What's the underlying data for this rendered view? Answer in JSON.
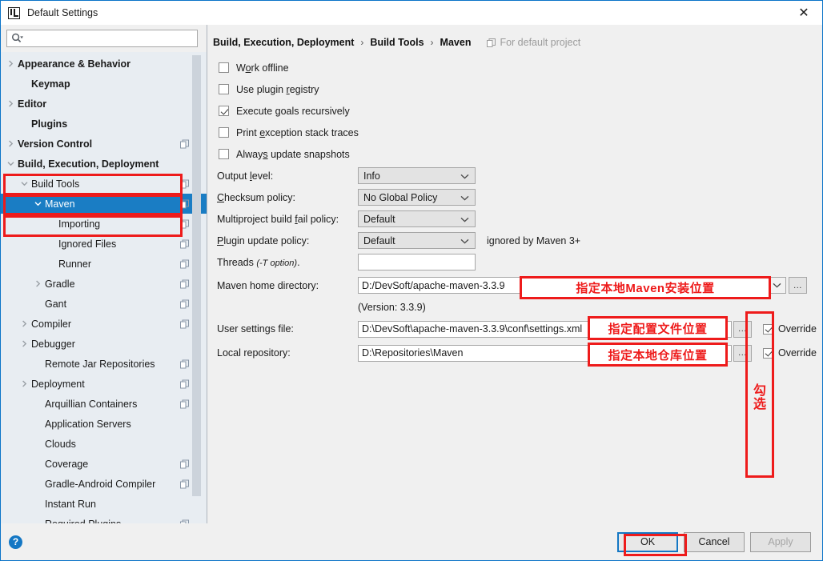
{
  "window": {
    "title": "Default Settings",
    "logo_icon": "intellij-idea-logo",
    "close_icon": "close-icon"
  },
  "search": {
    "placeholder": "",
    "value": "",
    "icon": "search-icon"
  },
  "sidebar": {
    "items": [
      {
        "label": "Appearance & Behavior",
        "arrow": "chevron-right",
        "bold": true,
        "indent": 0,
        "badge": false,
        "selected": false
      },
      {
        "label": "Keymap",
        "arrow": "none",
        "bold": true,
        "indent": 1,
        "badge": false,
        "selected": false
      },
      {
        "label": "Editor",
        "arrow": "chevron-right",
        "bold": true,
        "indent": 0,
        "badge": false,
        "selected": false
      },
      {
        "label": "Plugins",
        "arrow": "none",
        "bold": true,
        "indent": 1,
        "badge": false,
        "selected": false
      },
      {
        "label": "Version Control",
        "arrow": "chevron-right",
        "bold": true,
        "indent": 0,
        "badge": true,
        "selected": false
      },
      {
        "label": "Build, Execution, Deployment",
        "arrow": "chevron-down",
        "bold": true,
        "indent": 0,
        "badge": false,
        "selected": false
      },
      {
        "label": "Build Tools",
        "arrow": "chevron-down",
        "bold": false,
        "indent": 1,
        "badge": true,
        "selected": false
      },
      {
        "label": "Maven",
        "arrow": "chevron-down",
        "bold": false,
        "indent": 2,
        "badge": true,
        "selected": true
      },
      {
        "label": "Importing",
        "arrow": "none",
        "bold": false,
        "indent": 3,
        "badge": true,
        "selected": false
      },
      {
        "label": "Ignored Files",
        "arrow": "none",
        "bold": false,
        "indent": 3,
        "badge": true,
        "selected": false
      },
      {
        "label": "Runner",
        "arrow": "none",
        "bold": false,
        "indent": 3,
        "badge": true,
        "selected": false
      },
      {
        "label": "Gradle",
        "arrow": "chevron-right",
        "bold": false,
        "indent": 2,
        "badge": true,
        "selected": false
      },
      {
        "label": "Gant",
        "arrow": "none",
        "bold": false,
        "indent": 2,
        "badge": true,
        "selected": false
      },
      {
        "label": "Compiler",
        "arrow": "chevron-right",
        "bold": false,
        "indent": 1,
        "badge": true,
        "selected": false
      },
      {
        "label": "Debugger",
        "arrow": "chevron-right",
        "bold": false,
        "indent": 1,
        "badge": false,
        "selected": false
      },
      {
        "label": "Remote Jar Repositories",
        "arrow": "none",
        "bold": false,
        "indent": 2,
        "badge": true,
        "selected": false
      },
      {
        "label": "Deployment",
        "arrow": "chevron-right",
        "bold": false,
        "indent": 1,
        "badge": true,
        "selected": false
      },
      {
        "label": "Arquillian Containers",
        "arrow": "none",
        "bold": false,
        "indent": 2,
        "badge": true,
        "selected": false
      },
      {
        "label": "Application Servers",
        "arrow": "none",
        "bold": false,
        "indent": 2,
        "badge": false,
        "selected": false
      },
      {
        "label": "Clouds",
        "arrow": "none",
        "bold": false,
        "indent": 2,
        "badge": false,
        "selected": false
      },
      {
        "label": "Coverage",
        "arrow": "none",
        "bold": false,
        "indent": 2,
        "badge": true,
        "selected": false
      },
      {
        "label": "Gradle-Android Compiler",
        "arrow": "none",
        "bold": false,
        "indent": 2,
        "badge": true,
        "selected": false
      },
      {
        "label": "Instant Run",
        "arrow": "none",
        "bold": false,
        "indent": 2,
        "badge": false,
        "selected": false
      },
      {
        "label": "Required Plugins",
        "arrow": "none",
        "bold": false,
        "indent": 2,
        "badge": true,
        "selected": false
      }
    ]
  },
  "breadcrumb": {
    "crumbs": [
      "Build, Execution, Deployment",
      "Build Tools",
      "Maven"
    ],
    "separator": "›",
    "project_scope": "For default project",
    "project_scope_icon": "copy-badge-icon"
  },
  "main": {
    "checkboxes": [
      {
        "label": "Work offline",
        "mnemonic": "o",
        "checked": false
      },
      {
        "label": "Use plugin registry",
        "mnemonic": "r",
        "checked": false
      },
      {
        "label": "Execute goals recursively",
        "mnemonic": "g",
        "checked": true
      },
      {
        "label": "Print exception stack traces",
        "mnemonic": "e",
        "checked": false
      },
      {
        "label": "Always update snapshots",
        "mnemonic": "s",
        "checked": false
      }
    ],
    "combos": [
      {
        "label": "Output level:",
        "mnemonic": "l",
        "value": "Info",
        "hint": ""
      },
      {
        "label": "Checksum policy:",
        "mnemonic": "C",
        "value": "No Global Policy",
        "hint": ""
      },
      {
        "label": "Multiproject build fail policy:",
        "mnemonic": "f",
        "value": "Default",
        "hint": ""
      },
      {
        "label": "Plugin update policy:",
        "mnemonic": "P",
        "value": "Default",
        "hint": "ignored by Maven 3+"
      }
    ],
    "threads": {
      "label": "Threads",
      "label_suffix": "(-T option)",
      "value": ""
    },
    "maven_home": {
      "label": "Maven home directory:",
      "mnemonic": "h",
      "value": "D:/DevSoft/apache-maven-3.3.9",
      "chevron_icon": "chevron-down-icon",
      "browse_label": "...",
      "version_note": "(Version: 3.3.9)"
    },
    "user_settings": {
      "label": "User settings file:",
      "mnemonic": "s",
      "value": "D:\\DevSoft\\apache-maven-3.3.9\\conf\\settings.xml",
      "browse_label": "...",
      "override_label": "Override",
      "override_checked": true
    },
    "local_repository": {
      "label": "Local repository:",
      "mnemonic": "r",
      "value": "D:\\Repositories\\Maven",
      "browse_label": "...",
      "override_label": "Override",
      "override_checked": true
    }
  },
  "annotations": {
    "color": "#ee1b1b",
    "maven_home_note": "指定本地Maven安装位置",
    "settings_note": "指定配置文件位置",
    "repo_note": "指定本地仓库位置",
    "check_note_line1": "勾",
    "check_note_line2": "选"
  },
  "footer": {
    "help_icon": "help-icon",
    "help_label": "?",
    "ok_label": "OK",
    "cancel_label": "Cancel",
    "apply_label": "Apply",
    "apply_disabled": true
  }
}
